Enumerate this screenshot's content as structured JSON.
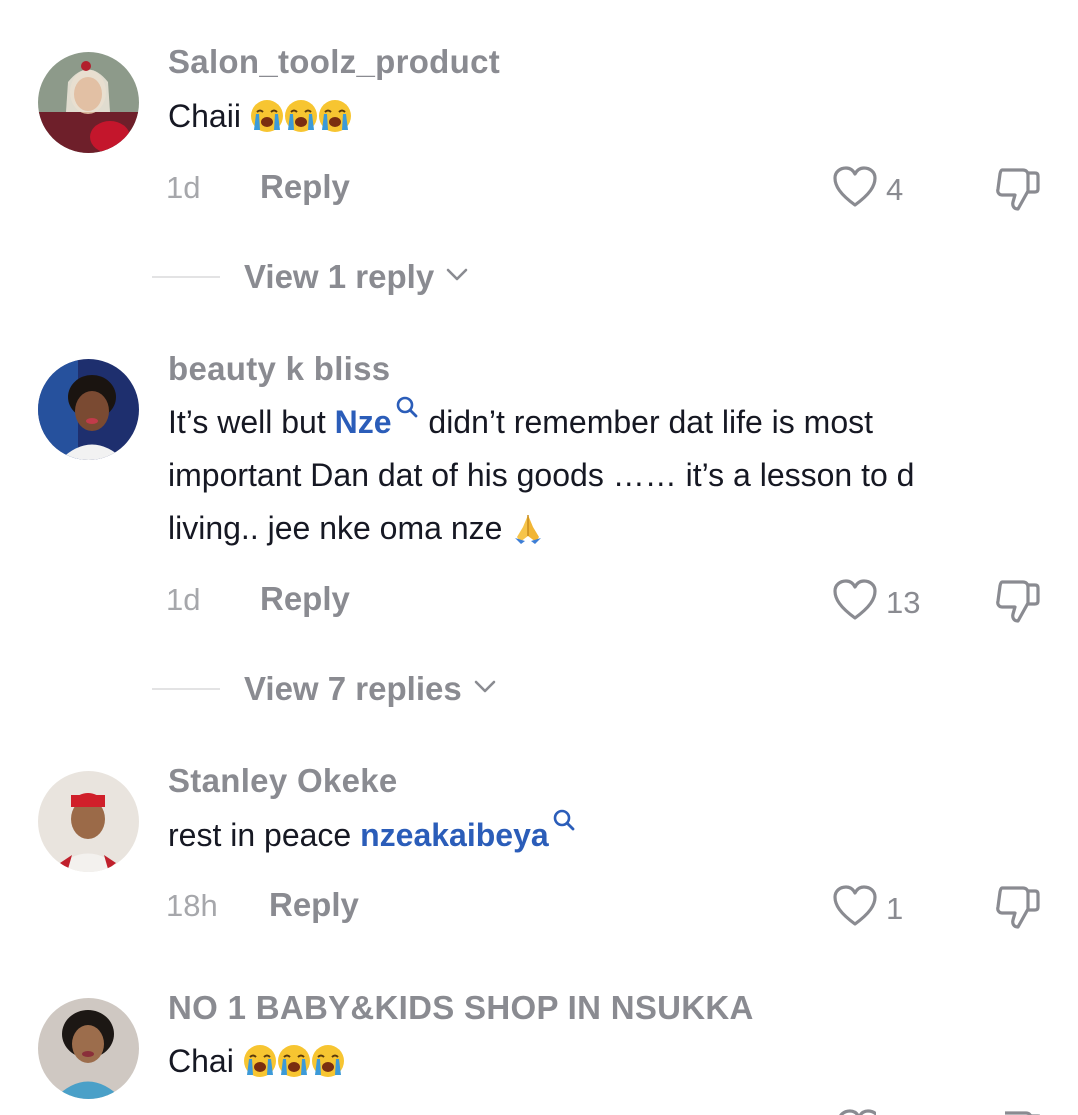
{
  "comments": [
    {
      "username": "Salon_toolz_product",
      "text_before": "Chaii",
      "time": "1d",
      "reply_label": "Reply",
      "likes": "4",
      "view_replies": "View 1 reply"
    },
    {
      "username": "beauty k bliss",
      "line1_before": "It’s well but",
      "mention": "Nze",
      "line1_after": "didn’t remember dat life is most",
      "line2": "important Dan dat of his goods …… it’s a lesson to d",
      "line3": "living.. jee nke oma nze",
      "time": "1d",
      "reply_label": "Reply",
      "likes": "13",
      "view_replies": "View 7 replies"
    },
    {
      "username": "Stanley Okeke",
      "text_before": "rest in peace",
      "mention": "nzeakaibeya",
      "time": "18h",
      "reply_label": "Reply",
      "likes": "1"
    },
    {
      "username": "NO 1 BABY&KIDS SHOP IN NSUKKA",
      "text_before": "Chai"
    }
  ],
  "icons": {
    "emoji_cry": "loudly-crying-face",
    "emoji_pray": "folded-hands",
    "like": "heart-outline-icon",
    "dislike": "thumbs-down-icon",
    "mention": "search-icon",
    "chevron": "chevron-down-icon"
  },
  "colors": {
    "mention": "#2b5db9",
    "muted": "#8a8b91",
    "text": "#161823"
  }
}
